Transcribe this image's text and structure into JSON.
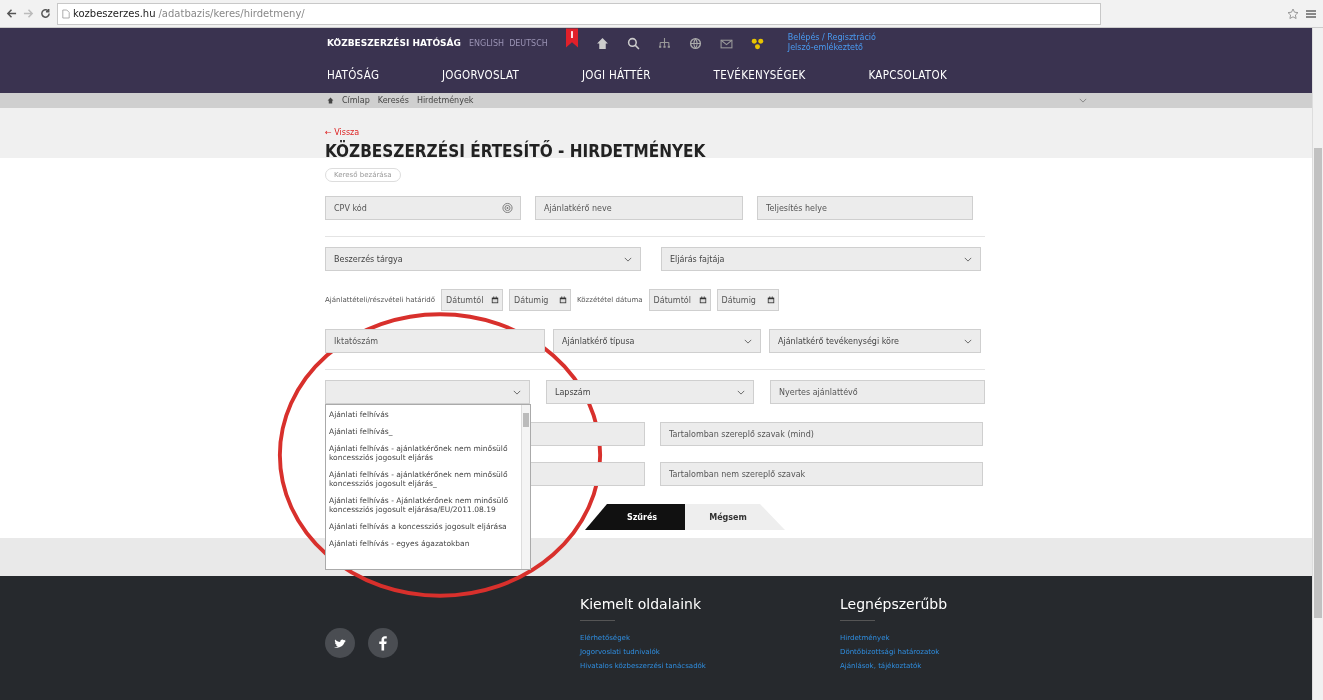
{
  "browser": {
    "url_host": "kozbeszerzes.hu",
    "url_path": "/adatbazis/keres/hirdetmeny/"
  },
  "header": {
    "brand": "KÖZBESZERZÉSI HATÓSÁG",
    "languages": "ENGLISH  DEUTSCH",
    "account_links": [
      "Belépés / Regisztráció",
      "Jelszó-emlékeztető"
    ],
    "nav": [
      "HATÓSÁG",
      "JOGORVOSLAT",
      "JOGI HÁTTÉR",
      "TEVÉKENYSÉGEK",
      "KAPCSOLATOK"
    ]
  },
  "breadcrumb": [
    "Címlap",
    "Keresés",
    "Hirdetmények"
  ],
  "back_link": "← Vissza",
  "title": "KÖZBESZERZÉSI ÉRTESÍTŐ - HIRDETMÉNYEK",
  "close_search": "Kereső bezárása",
  "form_rows": [
    [
      {
        "kind": "text",
        "placeholder": "CPV kód",
        "icon": true
      },
      {
        "kind": "text",
        "placeholder": "Ajánlatkérő neve"
      },
      {
        "kind": "text",
        "placeholder": "Teljesítés helye"
      }
    ],
    [
      {
        "kind": "select",
        "value": "Beszerzés tárgya"
      },
      {
        "kind": "select",
        "value": "Eljárás fajtája"
      }
    ],
    [
      {
        "kind": "label",
        "text": "Ajánlattételi/részvételi határidő"
      },
      {
        "kind": "date",
        "placeholder": "Dátumtól"
      },
      {
        "kind": "date",
        "placeholder": "Dátumig"
      },
      {
        "kind": "label",
        "text": "Közzététel dátuma"
      },
      {
        "kind": "date",
        "placeholder": "Dátumtól"
      },
      {
        "kind": "date",
        "placeholder": "Dátumig"
      }
    ],
    [
      {
        "kind": "text",
        "placeholder": "Iktatószám"
      },
      {
        "kind": "select",
        "value": "Ajánlatkérő típusa"
      },
      {
        "kind": "select",
        "value": "Ajánlatkérő tevékenységi köre"
      }
    ],
    [
      {
        "kind": "select",
        "expanded": true,
        "options": [
          "Ajánlati felhívás",
          "Ajánlati felhívás_",
          "Ajánlati felhívás - ajánlatkérőnek nem minősülő koncessziós jogosult eljárás",
          "Ajánlati felhívás - ajánlatkérőnek nem minősülő koncessziós jogosult eljárás_",
          "Ajánlati felhívás - Ajánlatkérőnek nem minősülő koncessziós jogosult eljárása/EU/2011.08.19",
          "Ajánlati felhívás a koncessziós jogosult eljárása",
          "Ajánlati felhívás - egyes ágazatokban"
        ]
      },
      {
        "kind": "select",
        "value": "Lapszám"
      },
      {
        "kind": "text",
        "placeholder": "Nyertes ajánlattévő"
      }
    ],
    [
      {
        "kind": "text"
      },
      {
        "kind": "text",
        "placeholder": "Tartalomban szereplő szavak (mind)"
      }
    ],
    [
      {
        "kind": "text"
      },
      {
        "kind": "text",
        "placeholder": "Tartalomban nem szereplő szavak"
      }
    ]
  ],
  "buttons": [
    {
      "label": "Szűrés",
      "kind": "primary"
    },
    {
      "label": "Mégsem",
      "kind": "secondary"
    }
  ],
  "footer": {
    "columns": [
      {
        "heading": "Kiemelt oldalaink",
        "links": [
          "Elérhetőségek",
          "Jogorvoslati tudnivalók",
          "Hivatalos közbeszerzési tanácsadók"
        ]
      },
      {
        "heading": "Legnépszerűbb",
        "links": [
          "Hirdetmények",
          "Döntőbizottsági határozatok",
          "Ajánlások, tájékoztatók"
        ]
      }
    ]
  }
}
